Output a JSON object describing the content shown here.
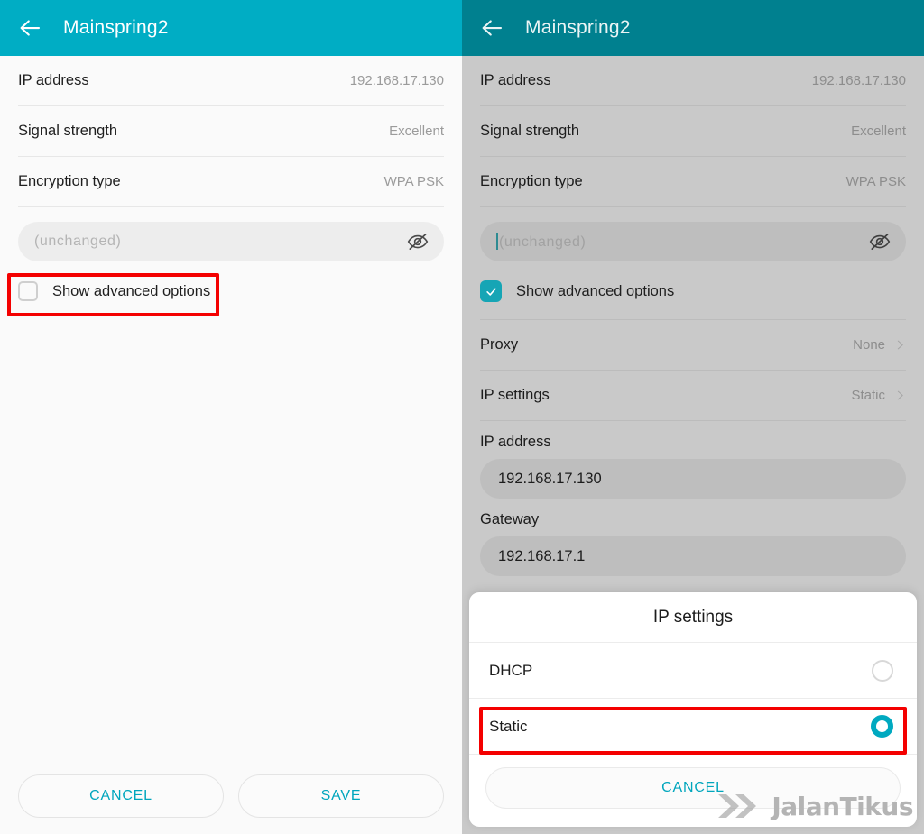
{
  "left_panel": {
    "appbar": {
      "title": "Mainspring2",
      "back_icon": "arrow-left-icon"
    },
    "info_rows": [
      {
        "label": "IP address",
        "value": "192.168.17.130"
      },
      {
        "label": "Signal strength",
        "value": "Excellent"
      },
      {
        "label": "Encryption type",
        "value": "WPA PSK"
      }
    ],
    "password": {
      "placeholder": "(unchanged)",
      "value": "",
      "toggle_icon": "eye-off-icon"
    },
    "advanced_checkbox": {
      "label": "Show advanced options",
      "checked": false
    },
    "buttons": {
      "cancel": "CANCEL",
      "save": "SAVE"
    },
    "highlight_color": "#f40000",
    "accent_color": "#00adc4"
  },
  "right_panel": {
    "appbar": {
      "title": "Mainspring2",
      "back_icon": "arrow-left-icon"
    },
    "info_rows": [
      {
        "label": "IP address",
        "value": "192.168.17.130"
      },
      {
        "label": "Signal strength",
        "value": "Excellent"
      },
      {
        "label": "Encryption type",
        "value": "WPA PSK"
      }
    ],
    "password": {
      "placeholder": "(unchanged)",
      "value": "",
      "toggle_icon": "eye-off-icon"
    },
    "advanced_checkbox": {
      "label": "Show advanced options",
      "checked": true
    },
    "nav_rows": [
      {
        "label": "Proxy",
        "value": "None",
        "chevron": "chevron-right-icon"
      },
      {
        "label": "IP settings",
        "value": "Static",
        "chevron": "chevron-right-icon"
      }
    ],
    "fields": [
      {
        "label": "IP address",
        "value": "192.168.17.130"
      },
      {
        "label": "Gateway",
        "value": "192.168.17.1"
      }
    ],
    "accent_color": "#00808f",
    "highlight_color": "#f40000"
  },
  "dialog": {
    "title": "IP settings",
    "options": [
      {
        "label": "DHCP",
        "selected": false
      },
      {
        "label": "Static",
        "selected": true
      }
    ],
    "cancel": "CANCEL",
    "selected_color": "#00a9c0"
  },
  "watermark": {
    "text": "JalanTikus",
    "icon": "double-chevron-icon"
  }
}
